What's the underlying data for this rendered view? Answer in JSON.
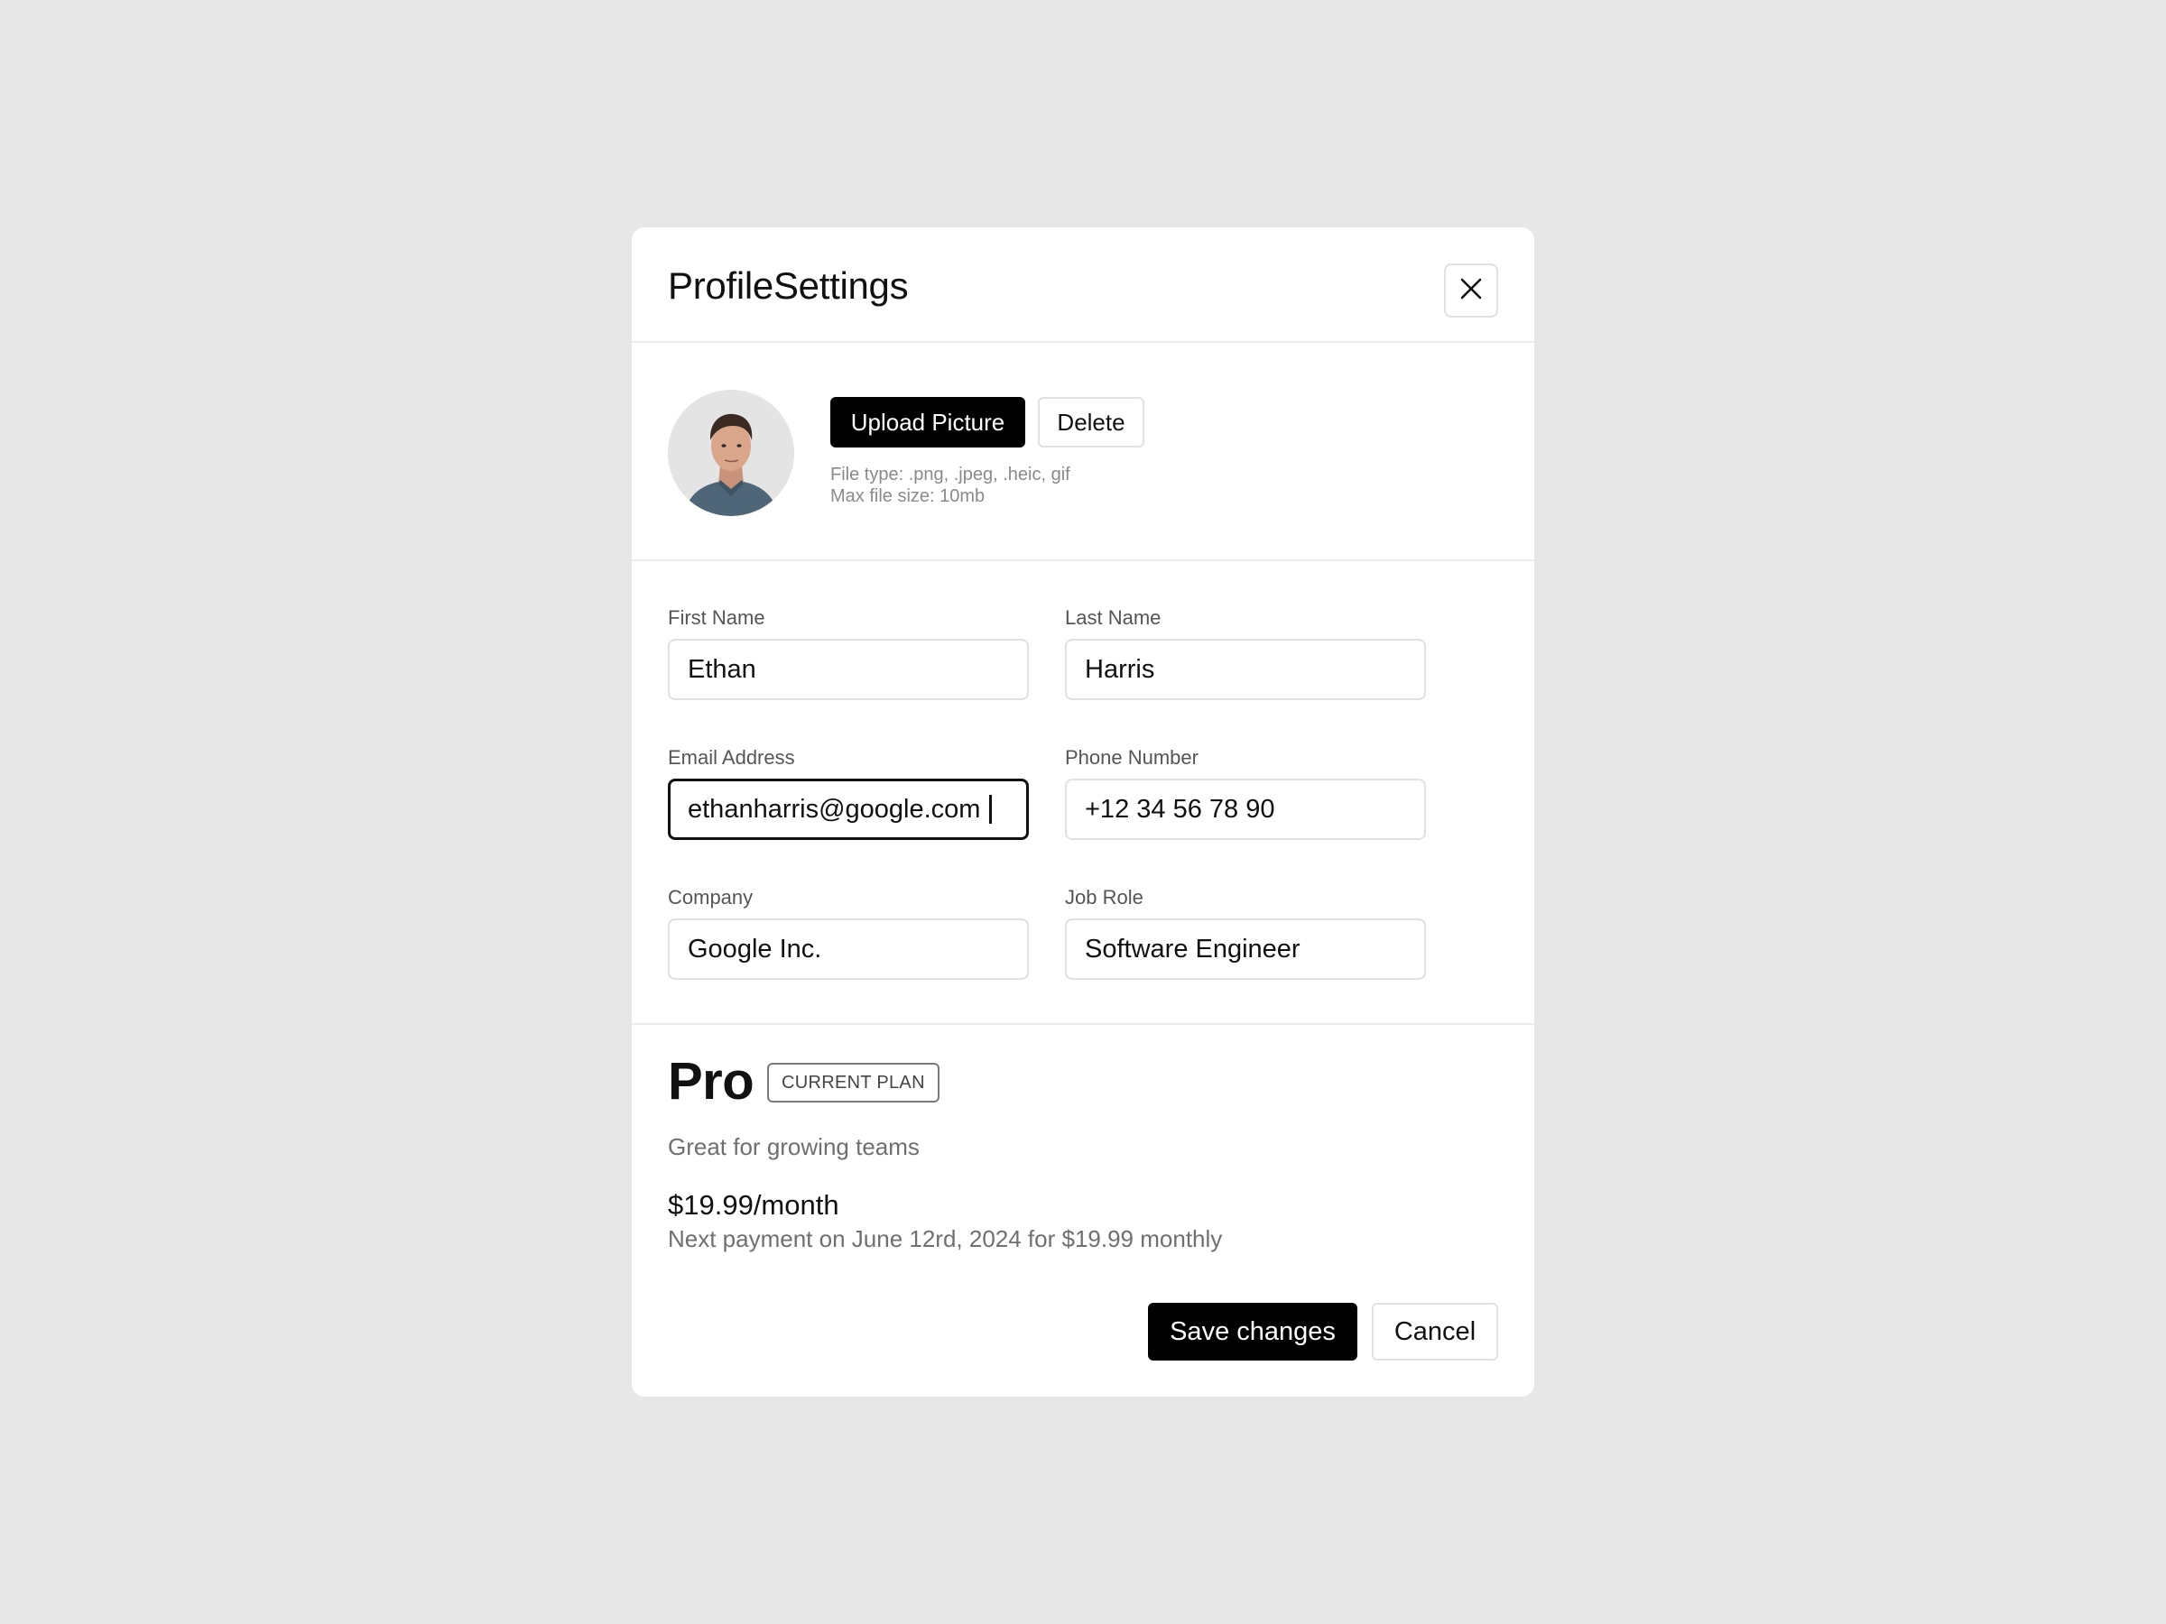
{
  "dialog": {
    "title": "ProfileSettings",
    "close_icon": "close-icon"
  },
  "avatar": {
    "icon": "user-photo"
  },
  "upload": {
    "upload_label": "Upload Picture",
    "delete_label": "Delete",
    "file_types": "File type: .png, .jpeg, .heic, gif",
    "max_size": "Max file size: 10mb"
  },
  "form": {
    "first_name": {
      "label": "First Name",
      "value": "Ethan"
    },
    "last_name": {
      "label": "Last Name",
      "value": "Harris"
    },
    "email": {
      "label": "Email Address",
      "value": "ethanharris@google.com"
    },
    "phone": {
      "label": "Phone Number",
      "value": "+12 34 56 78 90"
    },
    "company": {
      "label": "Company",
      "value": "Google Inc."
    },
    "job_role": {
      "label": "Job Role",
      "value": "Software Engineer"
    }
  },
  "plan": {
    "name": "Pro",
    "badge": "CURRENT PLAN",
    "description": "Great for growing teams",
    "price": "$19.99/month",
    "next_payment": "Next payment on June 12rd, 2024 for $19.99 monthly"
  },
  "footer": {
    "save_label": "Save changes",
    "cancel_label": "Cancel"
  },
  "colors": {
    "background": "#e7e7e7",
    "surface": "#ffffff",
    "primary": "#000000",
    "border": "#e1e1e1",
    "muted_text": "#6f6f6f"
  }
}
